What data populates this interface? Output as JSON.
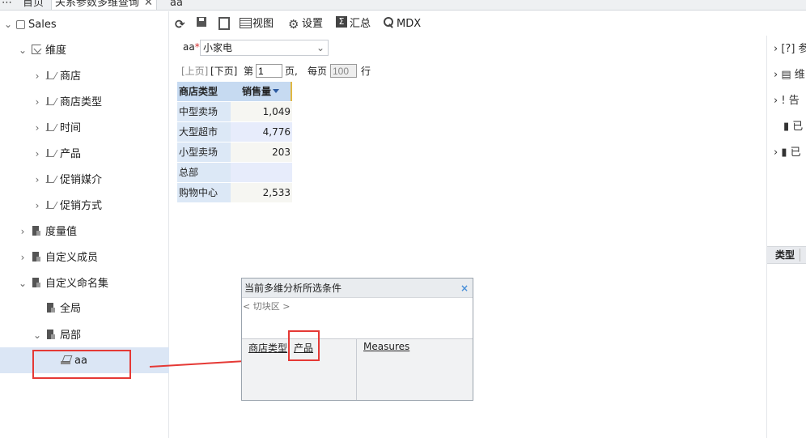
{
  "tabs": [
    {
      "label": "首页",
      "active": false
    },
    {
      "label": "关系参数多维查询",
      "active": true,
      "close": "✕"
    },
    {
      "label": "aa",
      "active": false
    }
  ],
  "tree": {
    "root": "Sales",
    "dimension_group": "维度",
    "dimensions": [
      "商店",
      "商店类型",
      "时间",
      "产品",
      "促销媒介",
      "促销方式"
    ],
    "measures": "度量值",
    "custom_members": "自定义成员",
    "custom_named_sets": "自定义命名集",
    "global": "全局",
    "local": "局部",
    "selected_item": "aa"
  },
  "toolbar": {
    "view": "视图",
    "settings": "设置",
    "summary": "汇总",
    "mdx": "MDX"
  },
  "parameter": {
    "label": "aa",
    "required_mark": "*",
    "value": "小家电"
  },
  "pager": {
    "prev": "[上页]",
    "next": "[下页]",
    "page_prefix": "第",
    "page_value": "1",
    "page_suffix": "页,",
    "per_page_prefix": "每页",
    "per_page_value": "100",
    "per_page_suffix": "行"
  },
  "grid": {
    "headers": [
      "商店类型",
      "销售量"
    ],
    "rows": [
      {
        "label": "中型卖场",
        "value": "1,049"
      },
      {
        "label": "大型超市",
        "value": "4,776"
      },
      {
        "label": "小型卖场",
        "value": "203"
      },
      {
        "label": "总部",
        "value": ""
      },
      {
        "label": "购物中心",
        "value": "2,533"
      }
    ]
  },
  "right_panel": {
    "items": [
      {
        "arrow": "›",
        "icon": "[?]",
        "text": "参"
      },
      {
        "arrow": "›",
        "icon": "▤",
        "text": "维"
      },
      {
        "arrow": "›",
        "icon": "!",
        "text": "告"
      },
      {
        "arrow": "",
        "icon": "▮",
        "text": "已"
      },
      {
        "arrow": "›",
        "icon": "▮",
        "text": "已"
      }
    ],
    "header": "类型"
  },
  "popup": {
    "title": "当前多维分析所选条件",
    "close": "×",
    "slice_area": "< 切块区 >",
    "rows_fields": [
      "商店类型",
      "产品"
    ],
    "columns_fields": [
      "Measures"
    ]
  },
  "colors": {
    "highlight_red": "#e53935",
    "header_blue": "#c6daf1",
    "selection_blue": "#dbe6f5"
  }
}
